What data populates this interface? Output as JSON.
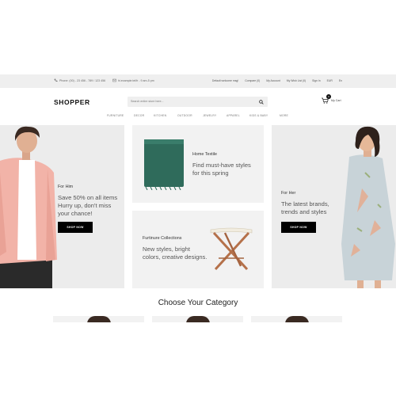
{
  "topbar": {
    "phone": "Phone: (00) - 23 456 - 789 / 123 456",
    "email": "hi.example.tel/fr - 9 am-5 pm",
    "links": [
      "Default welcome msg!",
      "Compare (0)",
      "My Account",
      "My Wish List (0)",
      "Sign In",
      "EUR",
      "En"
    ]
  },
  "header": {
    "logo": "SHOPPER",
    "search_placeholder": "Search entire store here...",
    "cart_count": "0",
    "cart_label": "My Cart"
  },
  "nav": [
    "FURNITURE",
    "DECOR",
    "KITCHEN",
    "OUTDOOR",
    "JEWELRY",
    "APPAREL",
    "KIDS & BABY",
    "MORE"
  ],
  "banners": {
    "for_him": {
      "kicker": "For Him",
      "text": [
        "Save 50% on all items",
        "Hurry up, don't miss",
        "your chance!"
      ],
      "button": "SHOP NOW"
    },
    "home_textile": {
      "kicker": "Home Textile",
      "text": [
        "Find must-have styles",
        "for this spring"
      ]
    },
    "furniture": {
      "kicker": "Furtinure Collections",
      "text": [
        "New styles, bright",
        "colors, creative designs."
      ]
    },
    "for_her": {
      "kicker": "For Her",
      "text": [
        "The latest brands,",
        "trends and styles"
      ],
      "button": "SHOP NOW"
    }
  },
  "categories_title": "Choose Your Category",
  "colors": {
    "accent": "#000000",
    "topbar_bg": "#efefef",
    "panel_bg": "#f2f2f2",
    "textile_green": "#2f6b5b",
    "wood": "#b5714a",
    "shirt_pink": "#f2b3a8"
  }
}
